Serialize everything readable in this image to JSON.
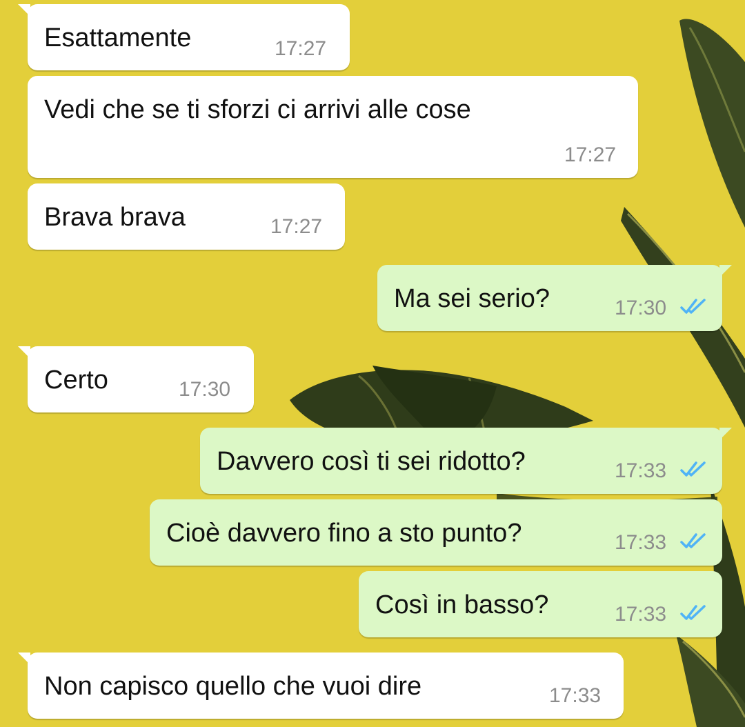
{
  "chat": {
    "messages": [
      {
        "direction": "incoming",
        "text": "Esattamente",
        "time": "17:27"
      },
      {
        "direction": "incoming",
        "text": "Vedi che se ti sforzi ci arrivi alle cose",
        "time": "17:27"
      },
      {
        "direction": "incoming",
        "text": "Brava brava",
        "time": "17:27"
      },
      {
        "direction": "outgoing",
        "text": "Ma sei serio?",
        "time": "17:30",
        "status": "read"
      },
      {
        "direction": "incoming",
        "text": "Certo",
        "time": "17:30"
      },
      {
        "direction": "outgoing",
        "text": "Davvero così ti sei ridotto?",
        "time": "17:33",
        "status": "read"
      },
      {
        "direction": "outgoing",
        "text": "Cioè davvero fino a sto punto?",
        "time": "17:33",
        "status": "read"
      },
      {
        "direction": "outgoing",
        "text": "Così in basso?",
        "time": "17:33",
        "status": "read"
      },
      {
        "direction": "incoming",
        "text": "Non capisco quello che vuoi dire",
        "time": "17:33"
      }
    ]
  },
  "theme": {
    "wallpaper_color": "#e3cf3a",
    "incoming_bubble_color": "#ffffff",
    "outgoing_bubble_color": "#dcf8c6",
    "read_tick_color": "#4fb3f6",
    "wallpaper_motif": "banana-leaves"
  }
}
